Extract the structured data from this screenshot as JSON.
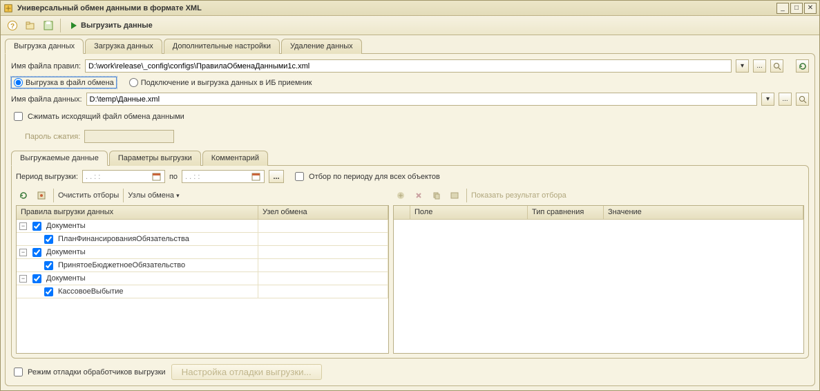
{
  "window": {
    "title": "Универсальный обмен данными в формате XML"
  },
  "toolbar": {
    "run_label": "Выгрузить данные"
  },
  "main_tabs": [
    {
      "label": "Выгрузка данных"
    },
    {
      "label": "Загрузка данных"
    },
    {
      "label": "Дополнительные настройки"
    },
    {
      "label": "Удаление данных"
    }
  ],
  "fields": {
    "rules_label": "Имя файла правил:",
    "rules_value": "D:\\work\\release\\_config\\configs\\ПравилаОбменаДанными1с.xml",
    "radio_file_label": "Выгрузка в файл обмена",
    "radio_ib_label": "Подключение и выгрузка данных в ИБ приемник",
    "data_label": "Имя файла данных:",
    "data_value": "D:\\temp\\Данные.xml",
    "compress_label": "Сжимать исходящий файл обмена данными",
    "password_label": "Пароль сжатия:"
  },
  "inner_tabs": [
    {
      "label": "Выгружаемые данные"
    },
    {
      "label": "Параметры выгрузки"
    },
    {
      "label": "Комментарий"
    }
  ],
  "period": {
    "label": "Период выгрузки:",
    "from_placeholder": "  .  .       :  :  ",
    "to_label": "по",
    "to_placeholder": "  .  .       :  :  ",
    "filter_all_label": "Отбор по периоду для всех объектов"
  },
  "left_toolbar": {
    "clear_label": "Очистить отборы",
    "nodes_label": "Узлы обмена"
  },
  "right_toolbar": {
    "show_result_label": "Показать результат отбора"
  },
  "left_grid": {
    "col_rules": "Правила выгрузки данных",
    "col_node": "Узел обмена",
    "rows": [
      {
        "level": 0,
        "expandable": true,
        "checked": true,
        "label": "Документы"
      },
      {
        "level": 1,
        "expandable": false,
        "checked": true,
        "label": "ПланФинансированияОбязательства"
      },
      {
        "level": 0,
        "expandable": true,
        "checked": true,
        "label": "Документы"
      },
      {
        "level": 1,
        "expandable": false,
        "checked": true,
        "label": "ПринятоеБюджетноеОбязательство"
      },
      {
        "level": 0,
        "expandable": true,
        "checked": true,
        "label": "Документы"
      },
      {
        "level": 1,
        "expandable": false,
        "checked": true,
        "label": "КассовоеВыбытие"
      }
    ]
  },
  "right_grid": {
    "col_field": "Поле",
    "col_compare": "Тип сравнения",
    "col_value": "Значение"
  },
  "footer": {
    "debug_label": "Режим отладки обработчиков выгрузки",
    "cfg_label": "Настройка отладки выгрузки..."
  }
}
